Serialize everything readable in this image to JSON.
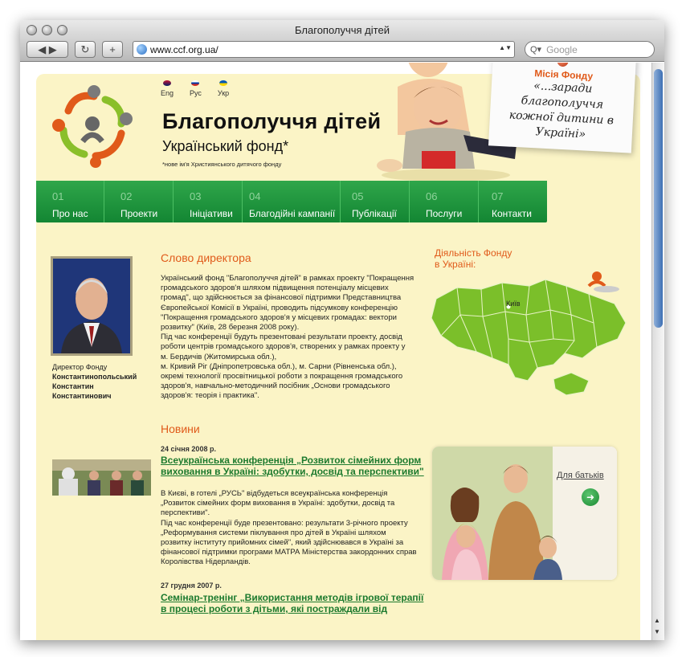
{
  "browser": {
    "window_title": "Благополуччя дітей",
    "url": "www.ccf.org.ua/",
    "search_placeholder": "Google",
    "back_forward": "◀ ▶",
    "reload": "↻",
    "add": "+"
  },
  "header": {
    "languages": [
      {
        "label": "Eng",
        "color": "#c8102e"
      },
      {
        "label": "Рус",
        "color": "#0039a6"
      },
      {
        "label": "Укр",
        "color": "#ffd500"
      }
    ],
    "brand_title": "Благополуччя  дітей",
    "brand_subtitle": "Український фонд*",
    "brand_note": "*нове ім'я Християнського дитячого фонду",
    "mission_title": "Місія Фонду",
    "mission_text": "«...заради благополуччя кожної дитини в Україні»"
  },
  "menu": [
    {
      "num": "01",
      "label": "Про нас"
    },
    {
      "num": "02",
      "label": "Проекти"
    },
    {
      "num": "03",
      "label": "Ініціативи"
    },
    {
      "num": "04",
      "label": "Благодійні кампанії"
    },
    {
      "num": "05",
      "label": "Публікації"
    },
    {
      "num": "06",
      "label": "Послуги"
    },
    {
      "num": "07",
      "label": "Контакти"
    }
  ],
  "director": {
    "section_title": "Слово директора",
    "role": "Директор Фонду",
    "name_line1": "Константинопольський",
    "name_line2": "Константин",
    "name_line3": "Константинович",
    "text": "Український фонд \"Благополуччя дітей\" в рамках проекту \"Покращення громадського здоров'я шляхом підвищення потенціалу місцевих громад\", що здійснюється за фінансової підтримки Представництва Європейської Комісії в Україні, проводить підсумкову конференцію \"Покращення громадського здоров'я у місцевих громадах: вектори розвитку\" (Київ, 28 березня 2008 року).\nПід час конференції будуть презентовані результати проекту, досвід роботи центрів громадського здоров'я, створених у рамках проекту у м. Бердичів (Житомирська обл.),\nм. Кривий Ріг (Дніпропетровська обл.), м. Сарни (Рівненська обл.), окремі технології просвітницької роботи з покращення громадського здоров'я, навчально-методичний посібник „Основи громадського здоров'я: теорія і практика\"."
  },
  "activity": {
    "title_line1": "Діяльність Фонду",
    "title_line2": "в Україні:",
    "city": "Київ"
  },
  "news": {
    "section_title": "Новини",
    "items": [
      {
        "date": "24 січня 2008 р.",
        "title": "Всеукраїнська конференція „Розвиток сімейних форм виховання в Україні: здобутки, досвід та перспективи\"",
        "text": "В Києві, в готелі „РУСЬ\" відбудеться всеукраїнська конференція „Розвиток сімейних форм виховання в Україні: здобутки, досвід та перспективи\".\nПід час конференції буде презентовано: результати 3-річного проекту „Реформування системи піклування про дітей в Україні шляхом розвитку інституту прийомних сімей\", який здійснювався в Україні за фінансової підтримки програми МАТРА Міністерства закордонних справ Королівства Нідерландів."
      },
      {
        "date": "27 грудня 2007 р.",
        "title": "Семінар-тренінг „Використання методів ігрової терапії в процесі роботи з дітьми, які постраждали від"
      }
    ]
  },
  "parents_box": {
    "label": "Для батьків",
    "arrow": "➜"
  },
  "colors": {
    "page_bg": "#fbf4c6",
    "menu_green": "#1e9a3b",
    "accent_orange": "#e05a1a",
    "link_green": "#1c7a2e",
    "map_green": "#7bbf2a"
  }
}
